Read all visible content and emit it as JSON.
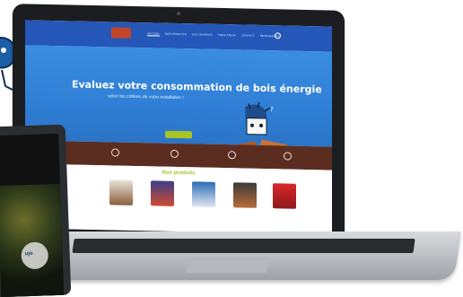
{
  "site": {
    "logo_text": "",
    "nav": [
      "ACCUEIL",
      "NOS PRODUITS",
      "LES CONSEILS",
      "SIMULATEUR",
      "CONTACT",
      "REVENDEURS"
    ],
    "hero": {
      "title": "Evaluez votre consommation de bois énergie",
      "subtitle": "selon les critères de votre installation !",
      "cta": ""
    },
    "features": [
      {
        "title": "",
        "text": ""
      },
      {
        "title": "",
        "text": ""
      },
      {
        "title": "",
        "text": ""
      },
      {
        "title": "",
        "text": ""
      },
      {
        "title": "",
        "text": ""
      }
    ],
    "products_title": "Nos produits",
    "products": [
      {
        "name": "",
        "desc": ""
      },
      {
        "name": "",
        "desc": ""
      },
      {
        "name": "",
        "desc": ""
      },
      {
        "name": "",
        "desc": ""
      },
      {
        "name": "",
        "desc": ""
      }
    ]
  },
  "tablet": {
    "badge_text": "ujo"
  },
  "colors": {
    "header": "#2457b8",
    "hero": "#2f7fd6",
    "band": "#5b2d20",
    "accent": "#a9c524",
    "laptop_frame": "#1b1d21"
  }
}
